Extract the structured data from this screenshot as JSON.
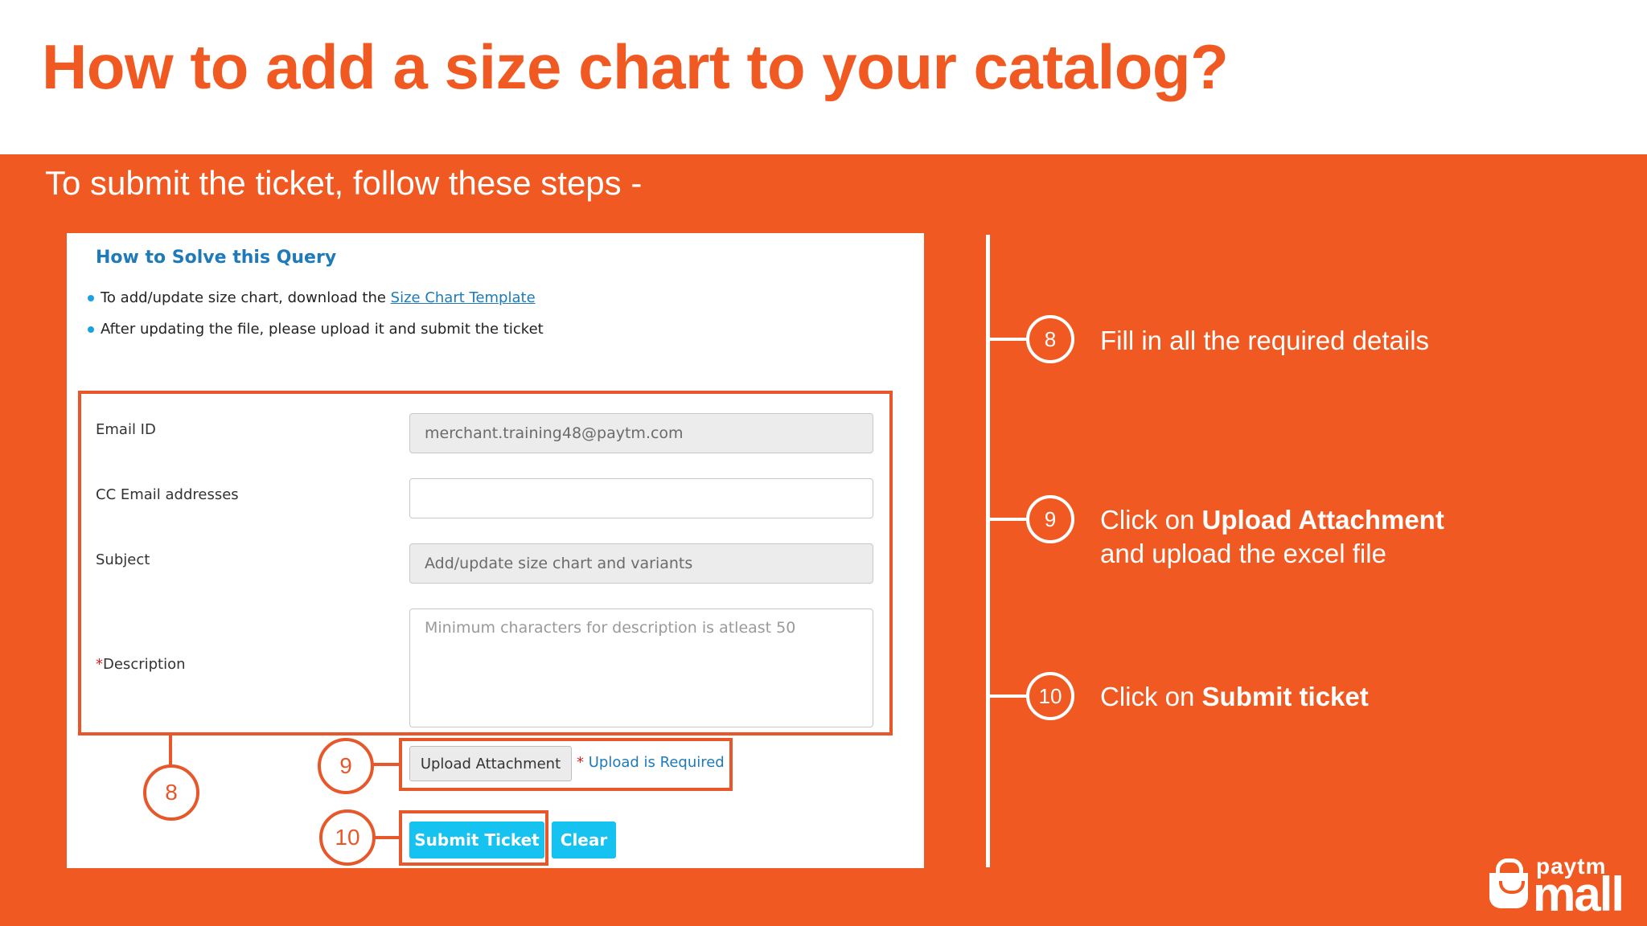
{
  "slide": {
    "title": "How to add a size chart to your catalog?",
    "subtitle": "To submit the ticket, follow these steps -",
    "colors": {
      "accent": "#f05a22",
      "link": "#1e7ab8",
      "button": "#16c2f0"
    }
  },
  "form": {
    "query_title": "How to Solve this Query",
    "bullet1_text": "To add/update size chart, download the ",
    "bullet1_link": "Size Chart Template",
    "bullet2_text": "After updating the file, please upload it and submit the ticket",
    "email_label": "Email ID",
    "email_value": "merchant.training48@paytm.com",
    "cc_label": "CC Email addresses",
    "cc_value": "",
    "subject_label": "Subject",
    "subject_value": "Add/update size chart and variants",
    "desc_required": "*",
    "desc_label": "Description",
    "desc_placeholder": "Minimum characters for description is atleast 50",
    "upload_button": "Upload Attachment",
    "upload_required_star": "*",
    "upload_required_text": " Upload is Required",
    "submit_button": "Submit Ticket",
    "clear_button": "Clear"
  },
  "callouts": {
    "c8": "8",
    "c9": "9",
    "c10": "10"
  },
  "steps": [
    {
      "num": "8",
      "text": "Fill in all the required details"
    },
    {
      "num": "9",
      "pre": "Click on ",
      "bold": "Upload Attachment",
      "line2": "and upload the excel file"
    },
    {
      "num": "10",
      "pre": "Click on ",
      "bold": "Submit ticket"
    }
  ],
  "logo": {
    "top": "paytm",
    "main": "mall",
    "icon": "shopping-bag-icon"
  }
}
